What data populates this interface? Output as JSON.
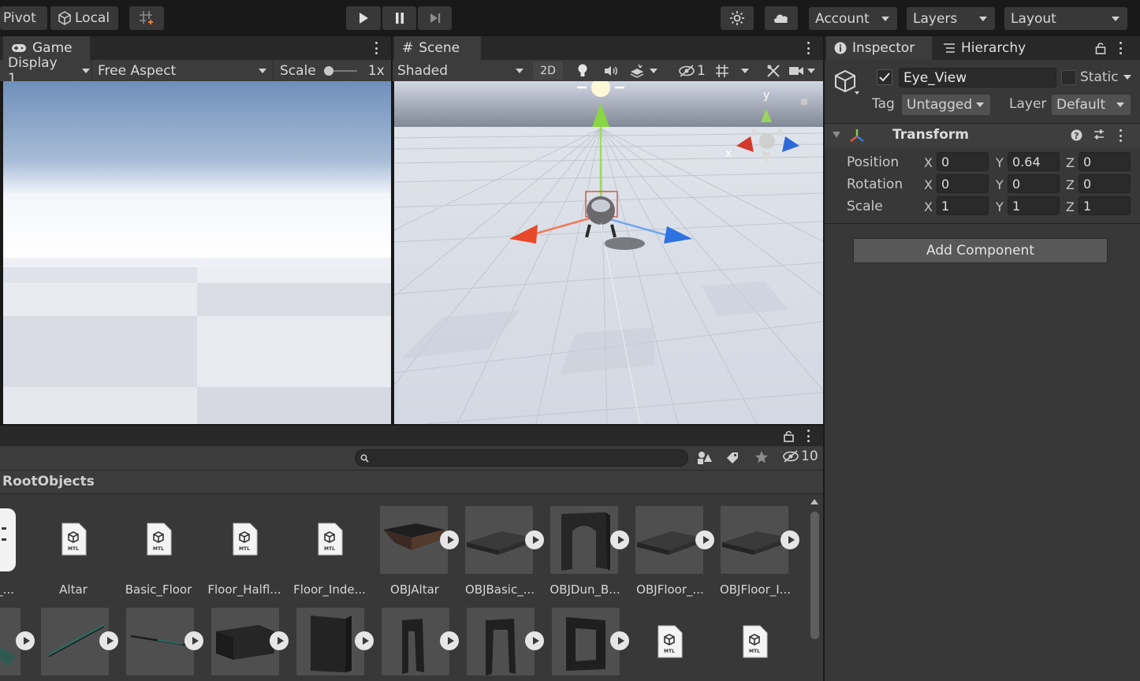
{
  "toolbar": {
    "pivot": "Pivot",
    "local": "Local",
    "account": "Account",
    "layers": "Layers",
    "layout": "Layout"
  },
  "game": {
    "tab": "Game",
    "display": "Display 1",
    "aspect": "Free Aspect",
    "scale_label": "Scale",
    "scale_value": "1x"
  },
  "scene": {
    "tab": "Scene",
    "shading": "Shaded",
    "mode_2d": "2D",
    "hidden_count": "1",
    "gizmo_y": "y",
    "gizmo_x": "x"
  },
  "inspector": {
    "tab": "Inspector",
    "hierarchy_tab": "Hierarchy",
    "object_name": "Eye_View",
    "active": true,
    "static_label": "Static",
    "tag_label": "Tag",
    "tag_value": "Untagged",
    "layer_label": "Layer",
    "layer_value": "Default",
    "component": "Transform",
    "position_label": "Position",
    "rotation_label": "Rotation",
    "scale_label": "Scale",
    "x": "X",
    "y": "Y",
    "z": "Z",
    "position": {
      "x": "0",
      "y": "0.64",
      "z": "0"
    },
    "rotation": {
      "x": "0",
      "y": "0",
      "z": "0"
    },
    "scale": {
      "x": "1",
      "y": "1",
      "z": "1"
    },
    "add_component": "Add Component"
  },
  "project": {
    "search_placeholder": "",
    "hidden_count": "10",
    "breadcrumb": "RootObjects",
    "row1": [
      {
        "label": "e_...",
        "kind": "partial"
      },
      {
        "label": "Altar",
        "kind": "mtl"
      },
      {
        "label": "Basic_Floor",
        "kind": "mtl"
      },
      {
        "label": "Floor_Halfl...",
        "kind": "mtl"
      },
      {
        "label": "Floor_Inde...",
        "kind": "mtl"
      },
      {
        "label": "OBJAltar",
        "kind": "model"
      },
      {
        "label": "OBJBasic_...",
        "kind": "model"
      },
      {
        "label": "OBJDun_B...",
        "kind": "model"
      },
      {
        "label": "OBJFloor_...",
        "kind": "model"
      },
      {
        "label": "OBJFloor_I...",
        "kind": "model"
      }
    ]
  },
  "colors": {
    "accent_blue": "#4d79c4",
    "panel": "#383838",
    "toolbar": "#191919"
  }
}
